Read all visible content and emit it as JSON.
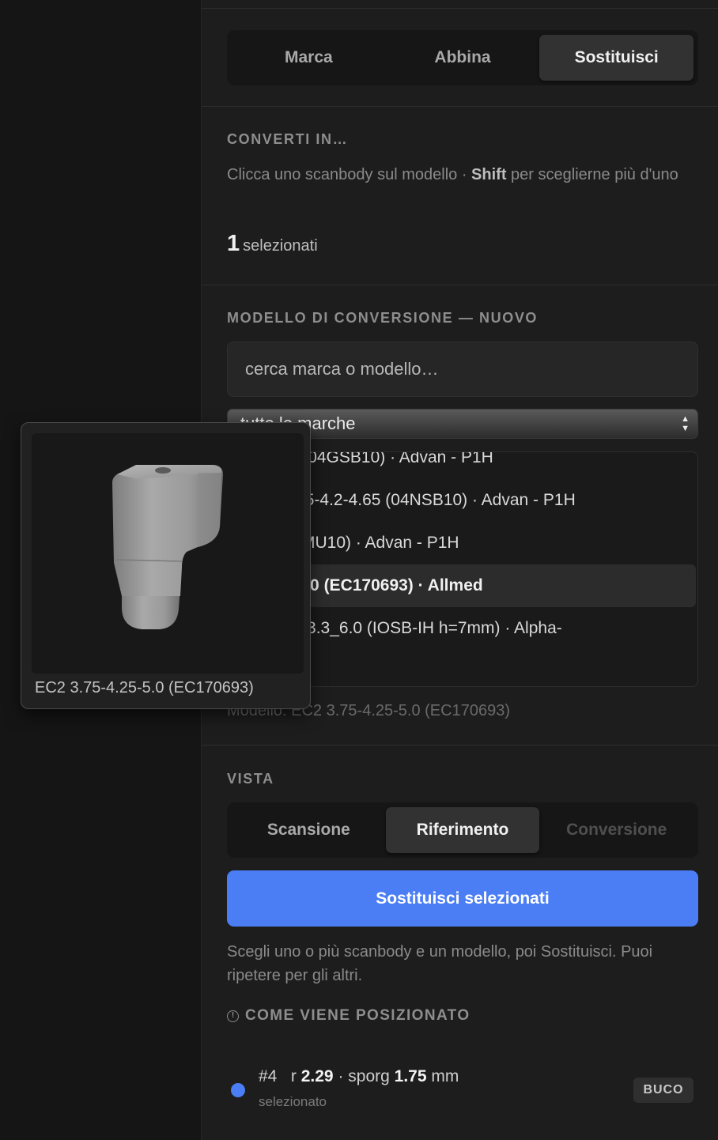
{
  "mode_tabs": [
    {
      "label": "Marca",
      "active": false
    },
    {
      "label": "Abbina",
      "active": false
    },
    {
      "label": "Sostituisci",
      "active": true
    }
  ],
  "convert": {
    "title": "CONVERTI IN…",
    "hint_prefix": "Clicca uno scanbody sul modello · ",
    "hint_bold": "Shift",
    "hint_suffix": " per sceglierne più d'uno",
    "selected_count": "1",
    "selected_label": "selezionati"
  },
  "model": {
    "title": "MODELLO DI CONVERSIONE — NUOVO",
    "search_placeholder": "cerca marca o modello…",
    "brand_select": "tutte le marche",
    "items": [
      {
        "text": "-3.6-4.3 (04GSB10) · Advan - P1H",
        "highlighted": false
      },
      {
        "text": "ernal 3.75-4.2-4.65 (04NSB10) · Advan - P1H",
        "highlighted": false
      },
      {
        "text": "TB (01SMU10) · Advan - P1H",
        "highlighted": false
      },
      {
        "text": "5-4.25-5.0 (EC170693) · Allmed",
        "highlighted": true
      },
      {
        "text": "rnal Hex 3.3_6.0 (IOSB-IH h=7mm) · Alpha-",
        "highlighted": false
      }
    ],
    "current": "Modello: EC2 3.75-4.25-5.0 (EC170693)"
  },
  "preview": {
    "caption": "EC2 3.75-4.25-5.0 (EC170693)"
  },
  "view": {
    "title": "VISTA",
    "tabs": [
      {
        "label": "Scansione",
        "state": "normal"
      },
      {
        "label": "Riferimento",
        "state": "active"
      },
      {
        "label": "Conversione",
        "state": "disabled"
      }
    ]
  },
  "action": {
    "replace_button": "Sostituisci selezionati",
    "help": "Scegli uno o più scanbody e un modello, poi Sostituisci. Puoi ripetere per gli altri."
  },
  "placement": {
    "title": "COME VIENE POSIZIONATO",
    "icon": "info-icon"
  },
  "selected_item": {
    "id": "#4",
    "r_label": "r",
    "r_value": "2.29",
    "sporg_label": "· sporg",
    "sporg_value": "1.75",
    "unit": "mm",
    "status": "selezionato",
    "badge": "BUCO",
    "dot_color": "#4b7ef5"
  },
  "colors": {
    "accent": "#4b7ef5"
  }
}
